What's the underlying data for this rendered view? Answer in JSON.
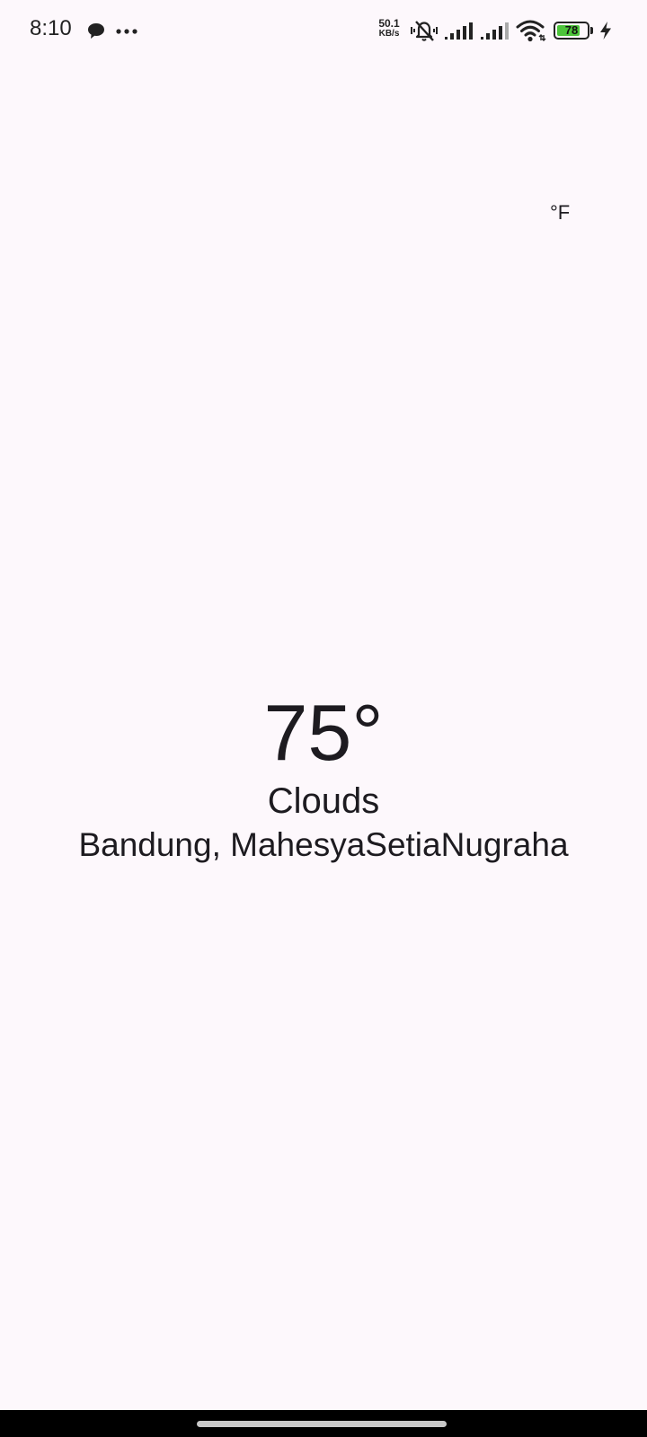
{
  "status_bar": {
    "time": "8:10",
    "network_rate": "50.1",
    "network_unit": "KB/s",
    "battery_level": 78,
    "battery_label": "78",
    "battery_color": "#4cc43a",
    "icons": [
      "chat-bubble-icon",
      "more-dots-icon",
      "vibrate-mute-icon",
      "signal-icon",
      "signal-icon",
      "wifi-icon",
      "battery-icon",
      "charging-bolt-icon"
    ]
  },
  "app": {
    "unit_toggle": "°F",
    "temperature": "75°",
    "condition": "Clouds",
    "location": "Bandung, MahesyaSetiaNugraha"
  },
  "colors": {
    "background": "#fdf8fc",
    "text": "#1d1b20"
  }
}
